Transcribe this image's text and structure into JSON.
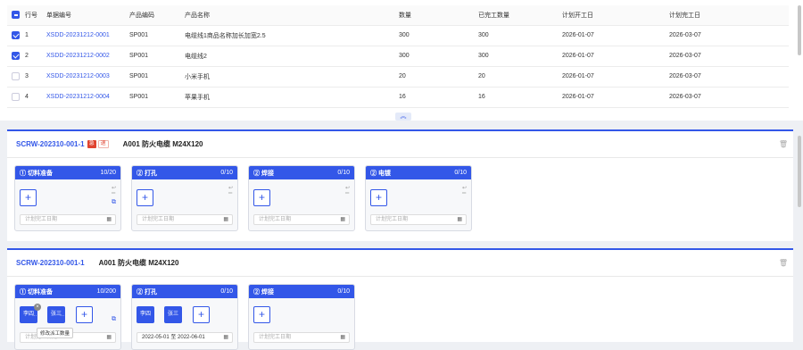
{
  "table": {
    "headers": {
      "row_no": "行号",
      "doc_no": "单据编号",
      "prod_code": "产品编码",
      "prod_name": "产品名称",
      "qty": "数量",
      "done_qty": "已完工数量",
      "plan_start": "计划开工日",
      "plan_end": "计划完工日"
    },
    "rows": [
      {
        "checked": true,
        "row_no": "1",
        "doc_no": "XSDD-20231212-0001",
        "prod_code": "SP001",
        "prod_name": "电缆线1商品名称加长加宽2.5",
        "qty": "300",
        "done_qty": "300",
        "plan_start": "2026-01-07",
        "plan_end": "2026-03-07"
      },
      {
        "checked": true,
        "row_no": "2",
        "doc_no": "XSDD-20231212-0002",
        "prod_code": "SP001",
        "prod_name": "电缆线2",
        "qty": "300",
        "done_qty": "300",
        "plan_start": "2026-01-07",
        "plan_end": "2026-03-07"
      },
      {
        "checked": false,
        "row_no": "3",
        "doc_no": "XSDD-20231212-0003",
        "prod_code": "SP001",
        "prod_name": "小米手机",
        "qty": "20",
        "done_qty": "20",
        "plan_start": "2026-01-07",
        "plan_end": "2026-03-07"
      },
      {
        "checked": false,
        "row_no": "4",
        "doc_no": "XSDD-20231212-0004",
        "prod_code": "SP001",
        "prod_name": "苹果手机",
        "qty": "16",
        "done_qty": "16",
        "plan_start": "2026-01-07",
        "plan_end": "2026-03-07"
      }
    ],
    "collapse_glyph": "︽"
  },
  "cards": [
    {
      "code": "SCRW-202310-001-1",
      "tag_urgent": "急",
      "tag_other": "退",
      "product": "A001  防火电缆  M24X120",
      "procs": [
        {
          "title": "① 切料准备",
          "count": "10/20",
          "date_placeholder": "计划完工日期"
        },
        {
          "title": "② 打孔",
          "count": "0/10",
          "date_placeholder": "计划完工日期"
        },
        {
          "title": "② 焊接",
          "count": "0/10",
          "date_placeholder": "计划完工日期"
        },
        {
          "title": "② 电镀",
          "count": "0/10",
          "date_placeholder": "计划完工日期"
        }
      ]
    },
    {
      "code": "SCRW-202310-001-1",
      "product": "A001  防火电缆  M24X120",
      "procs": [
        {
          "title": "① 切料准备",
          "count": "10/200",
          "workers": [
            "李四",
            "张三"
          ],
          "date_placeholder": "计划完工日期"
        },
        {
          "title": "② 打孔",
          "count": "0/10",
          "workers": [
            "李四",
            "张三"
          ],
          "date_value": "2022-05-01 至 2022-06-01"
        },
        {
          "title": "② 焊接",
          "count": "0/10",
          "date_placeholder": "计划完工日期"
        }
      ],
      "tooltip": "修改派工数量"
    }
  ],
  "icons": {
    "add": "+",
    "calendar": "▦",
    "trash": "🗑",
    "copy": "⧉",
    "close": "×",
    "dots": "···"
  },
  "colors": {
    "primary": "#3357e8",
    "urgent": "#e0432f"
  }
}
